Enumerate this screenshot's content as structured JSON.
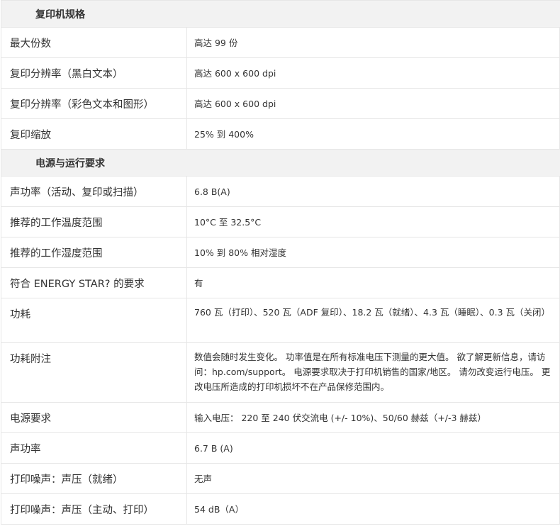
{
  "sections": [
    {
      "title": "复印机规格",
      "rows": [
        {
          "label": "最大份数",
          "value": "高达 99 份"
        },
        {
          "label": "复印分辨率（黑白文本）",
          "value": "高达 600 x 600 dpi"
        },
        {
          "label": "复印分辨率（彩色文本和图形）",
          "value": "高达 600 x 600 dpi"
        },
        {
          "label": "复印缩放",
          "value": "25% 到 400%"
        }
      ]
    },
    {
      "title": "电源与运行要求",
      "rows": [
        {
          "label": "声功率（活动、复印或扫描）",
          "value": "6.8 B(A)"
        },
        {
          "label": "推荐的工作温度范围",
          "value": "10°C 至 32.5°C"
        },
        {
          "label": "推荐的工作湿度范围",
          "value": "10% 到 80% 相对湿度"
        },
        {
          "label": "符合 ENERGY STAR? 的要求",
          "value": "有"
        },
        {
          "label": "功耗",
          "value": "760 瓦（打印）、520 瓦（ADF 复印）、18.2 瓦（就绪）、4.3 瓦（睡眠）、0.3 瓦（关闭）"
        },
        {
          "label": "功耗附注",
          "value": "数值会随时发生变化。 功率值是在所有标准电压下测量的更大值。 欲了解更新信息，请访问：hp.com/support。 电源要求取决于打印机销售的国家/地区。 请勿改变运行电压。 更改电压所造成的打印机损坏不在产品保修范围内。"
        },
        {
          "label": "电源要求",
          "value": "输入电压： 220 至 240 伏交流电 (+/- 10%)、50/60 赫兹（+/-3 赫兹）"
        },
        {
          "label": "声功率",
          "value": "6.7 B (A)"
        },
        {
          "label": "打印噪声：声压（就绪）",
          "value": "无声"
        },
        {
          "label": "打印噪声：声压（主动、打印）",
          "value": "54 dB（A）"
        }
      ]
    }
  ]
}
